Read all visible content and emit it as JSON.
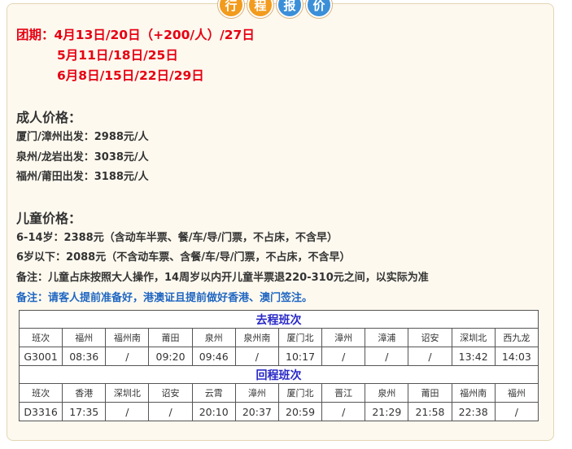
{
  "badges": [
    "行",
    "程",
    "报",
    "价"
  ],
  "dates": {
    "line1": "团期：4月13日/20日（+200/人）/27日",
    "line2": "5月11日/18日/25日",
    "line3": "6月8日/15日/22日/29日"
  },
  "adult": {
    "heading": "成人价格：",
    "rows": [
      "厦门/漳州出发：2988元/人",
      "泉州/龙岩出发：3038元/人",
      "福州/莆田出发：3188元/人"
    ]
  },
  "child": {
    "heading": "儿童价格：",
    "rows": [
      "6-14岁：2388元（含动车半票、餐/车/导/门票，不占床，不含早）",
      "6岁以下：2088元（不含动车票、含餐/车/导/门票，不占床，不含早）",
      "备注：儿童占床按照大人操作，14周岁以内开儿童半票退220-310元之间，以实际为准"
    ],
    "note": "备注：请客人提前准备好，港澳证且提前做好香港、澳门签注。"
  },
  "schedule": {
    "outbound": {
      "title": "去程班次",
      "stations": [
        "班次",
        "福州",
        "福州南",
        "莆田",
        "泉州",
        "泉州南",
        "厦门北",
        "漳州",
        "漳浦",
        "诏安",
        "深圳北",
        "西九龙"
      ],
      "times": [
        "G3001",
        "08:36",
        "/",
        "09:20",
        "09:46",
        "/",
        "10:17",
        "/",
        "/",
        "/",
        "13:42",
        "14:03"
      ]
    },
    "return": {
      "title": "回程班次",
      "stations": [
        "班次",
        "香港",
        "深圳北",
        "诏安",
        "云霄",
        "漳州",
        "厦门北",
        "晋江",
        "泉州",
        "莆田",
        "福州南",
        "福州"
      ],
      "times": [
        "D3316",
        "17:35",
        "/",
        "/",
        "20:10",
        "20:37",
        "20:59",
        "/",
        "21:29",
        "21:58",
        "22:38",
        "/"
      ]
    }
  }
}
